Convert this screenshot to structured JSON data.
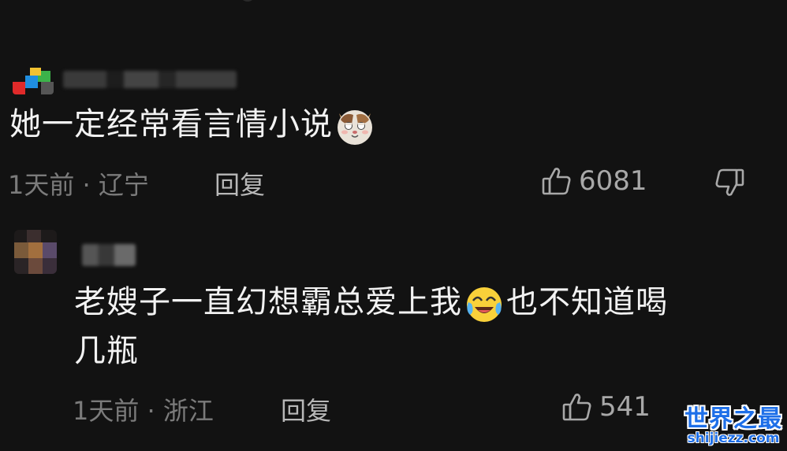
{
  "comments": [
    {
      "text": "她一定经常看言情小说",
      "emoji": "cat-face-emoji",
      "time": "1天前",
      "location": "辽宁",
      "reply_label": "回复",
      "likes": "6081"
    },
    {
      "text_line1": "老嫂子一直幻想霸总爱上我",
      "emoji": "tears-of-joy-emoji",
      "text_line1_after": "也不知道喝",
      "text_line2": "几瓶",
      "time": "1天前",
      "location": "浙江",
      "reply_label": "回复",
      "likes": "541"
    }
  ],
  "separator": "·",
  "watermark": {
    "title": "世界之最",
    "url": "shijiezz.com"
  },
  "colors": {
    "background": "#121212",
    "text": "#f2f2f2",
    "meta": "#7b7b7b",
    "watermark": "#1e6fe8"
  }
}
